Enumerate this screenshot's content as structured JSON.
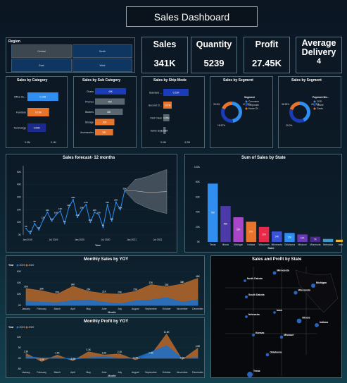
{
  "title": "Sales Dashboard",
  "kpis": [
    {
      "label": "Sales",
      "value": "341K"
    },
    {
      "label": "Quantity",
      "value": "5239"
    },
    {
      "label": "Profit",
      "value": "27.45K"
    },
    {
      "label": "Average Delivery",
      "value": "4"
    }
  ],
  "region": {
    "title": "Region",
    "options": [
      "Central",
      "South",
      "East",
      "West"
    ]
  },
  "colors": {
    "blue": "#2f8ef0",
    "darkblue": "#1a3cb8",
    "orange": "#e8732a",
    "navy": "#1b2a8c",
    "gray": "#5a6670"
  },
  "chart_data": [
    {
      "id": "category",
      "type": "bar",
      "title": "Sales by Category",
      "categories": [
        "Office Su...",
        "Furniture",
        "Technology"
      ],
      "values": [
        0.1,
        0.07,
        0.06
      ],
      "labels": [
        "0.10M",
        "0.07M",
        "0.06M"
      ],
      "ticks": [
        "0.0M",
        "0.1M"
      ]
    },
    {
      "id": "subcategory",
      "type": "bar",
      "title": "Sales by Sub Category",
      "categories": [
        "Chairs",
        "Phones",
        "Binders",
        "Storage",
        "Accessories"
      ],
      "values": [
        48,
        46,
        43,
        30,
        28
      ],
      "labels": [
        "48K",
        "46K",
        "43K",
        "30K",
        "28K"
      ]
    },
    {
      "id": "shipmode",
      "type": "bar",
      "title": "Sales by Ship Mode",
      "categories": [
        "Standard ...",
        "Second Cl...",
        "First Class",
        "Same Day"
      ],
      "values": [
        0.21,
        0.07,
        0.05,
        0.02
      ],
      "labels": [
        "0.21M",
        "0.07M",
        "0.05M",
        "0.02M"
      ],
      "ticks": [
        "0.0M",
        "0.2M"
      ]
    },
    {
      "id": "segment1",
      "type": "pie",
      "title": "Sales by Segment",
      "legend_title": "Segment",
      "legend": [
        "Consumer",
        "Corporate",
        "Home Of..."
      ],
      "values": [
        47.83,
        33.6,
        18.57
      ],
      "labels": [
        "47.83%",
        "33.6%",
        "18.57%"
      ],
      "colors": [
        "#2f8ef0",
        "#1a3cb8",
        "#e8732a"
      ]
    },
    {
      "id": "segment2",
      "type": "pie",
      "title": "Sales by Segment",
      "legend_title": "Payment Me...",
      "legend": [
        "COD",
        "Online",
        "Cards"
      ],
      "values": [
        43.07,
        36.93,
        20.0
      ],
      "labels": [
        "43.07%",
        "36.93%",
        "20.0%"
      ],
      "colors": [
        "#2f8ef0",
        "#1a3cb8",
        "#e8732a"
      ]
    },
    {
      "id": "forecast",
      "type": "line",
      "title": "Sales forecast- 12 months",
      "xlabel": "Year",
      "y_ticks": [
        "0K",
        "10K",
        "20K",
        "30K",
        "40K",
        "50K"
      ],
      "ylim": [
        0,
        55
      ],
      "x_ticks": [
        "Jan 2019",
        "Jul 2019",
        "Jan 2020",
        "Jul 2020",
        "Jan 2021",
        "Jul 2021"
      ],
      "values": [
        5,
        1,
        9,
        4,
        12,
        18,
        11,
        16,
        19,
        9,
        22,
        28,
        14,
        20,
        24,
        10,
        18,
        16,
        6,
        24,
        11,
        26,
        20,
        35
      ],
      "labels": [
        "5K",
        "1K",
        "9K",
        "4K",
        "12K",
        "18K",
        "11K",
        "16K",
        "19K",
        "9K",
        "22K",
        "28K",
        "14K",
        "20K",
        "24K",
        "10K",
        "18K",
        "16K",
        "6K",
        "24K",
        "11K",
        "26K",
        "20K",
        "35K"
      ],
      "forecast_low": [
        26,
        22,
        19,
        17
      ],
      "forecast_high": [
        44,
        46,
        49,
        52
      ]
    },
    {
      "id": "state",
      "type": "bar",
      "title": "Sum of Sales by State",
      "xlabel": "State",
      "y_ticks": [
        "0K",
        "20K",
        "40K",
        "60K",
        "80K",
        "100K"
      ],
      "ylim": [
        0,
        100
      ],
      "categories": [
        "Texas",
        "Illinois",
        "Michigan",
        "Indiana",
        "Wisconsin",
        "Minnesota",
        "Oklahoma",
        "Missouri",
        "Minnesota",
        "Nebraska",
        "Iowa"
      ],
      "values": [
        78,
        48,
        33,
        27,
        20,
        14,
        12,
        10,
        7,
        4,
        3
      ],
      "labels": [
        "78K",
        "48K",
        "33K",
        "27K",
        "20K",
        "14K",
        "12K",
        "10K",
        "7K",
        "",
        ""
      ],
      "colors": [
        "#2f8ef0",
        "#4b3aa8",
        "#a946c8",
        "#e8732a",
        "#e82a4a",
        "#3a54d8",
        "#2f8ef0",
        "#6a3ab8",
        "#4a2a8a",
        "#3a9ad0",
        "#e8b42a"
      ]
    },
    {
      "id": "monthly_sales",
      "type": "area",
      "title": "Monthly Sales by YOY",
      "legend_title": "Year",
      "xlabel": "Month",
      "series": [
        {
          "name": "2019",
          "values": [
            8,
            6,
            5,
            9,
            10,
            6,
            3,
            8,
            10,
            14,
            6,
            10
          ]
        },
        {
          "name": "2020",
          "values": [
            30,
            26,
            20,
            34,
            25,
            21,
            20,
            25,
            37,
            33,
            38,
            48
          ]
        }
      ],
      "labels": [
        "30K",
        "26K",
        "20K",
        "34K",
        "25K",
        "21K",
        "20K",
        "25K",
        "37K",
        "33K",
        "38K",
        "48K"
      ],
      "y_ticks": [
        "0K",
        "20K",
        "40K",
        "60K"
      ],
      "ylim": [
        0,
        60
      ],
      "categories": [
        "January",
        "February",
        "March",
        "April",
        "May",
        "June",
        "July",
        "August",
        "September",
        "October",
        "November",
        "December"
      ]
    },
    {
      "id": "monthly_profit",
      "type": "area",
      "title": "Monthly Profit by YOY",
      "legend_title": "Year",
      "xlabel": "Month",
      "series": [
        {
          "name": "2019",
          "values": [
            1,
            0.2,
            0.4,
            -0.5,
            0.3,
            1,
            0,
            0.2,
            3,
            6,
            0,
            0.5
          ]
        },
        {
          "name": "2020",
          "values": [
            2.3,
            -1.5,
            1.6,
            -1.2,
            3.1,
            1.6,
            2.1,
            -0.7,
            1.6,
            11.5,
            -0.6,
            4.8
          ]
        }
      ],
      "labels": [
        "2.3K",
        "-1.5K",
        "1.6K",
        "-1.2K",
        "3.1K",
        "1.6K",
        "2.1K",
        "-0.7K",
        "1.6K",
        "11.5K",
        "-0.6K",
        "4.8K"
      ],
      "y_ticks": [
        "-5K",
        "0K",
        "5K",
        "10K"
      ],
      "ylim": [
        -5,
        13
      ],
      "categories": [
        "January",
        "February",
        "March",
        "April",
        "May",
        "June",
        "July",
        "August",
        "September",
        "October",
        "November",
        "December"
      ]
    }
  ],
  "map": {
    "title": "Sales and Profit by State",
    "places": [
      {
        "name": "Minnesota",
        "v": 14
      },
      {
        "name": "North Dakota",
        "v": 4
      },
      {
        "name": "South Dakota",
        "v": 6
      },
      {
        "name": "Wisconsin",
        "v": 20
      },
      {
        "name": "Michigan",
        "v": 33
      },
      {
        "name": "Nebraska",
        "v": 4
      },
      {
        "name": "Iowa",
        "v": 3
      },
      {
        "name": "Illinois",
        "v": 48
      },
      {
        "name": "Indiana",
        "v": 27
      },
      {
        "name": "Kansas",
        "v": 5
      },
      {
        "name": "Missouri",
        "v": 10
      },
      {
        "name": "Oklahoma",
        "v": 12
      },
      {
        "name": "Texas",
        "v": 78
      }
    ]
  }
}
